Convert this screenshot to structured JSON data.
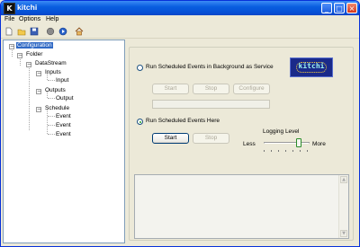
{
  "window": {
    "title": "kitchi",
    "icon_letter": "K",
    "controls": [
      "minimize-icon",
      "maximize-icon",
      "close-icon"
    ]
  },
  "menubar": {
    "items": [
      {
        "label": "File"
      },
      {
        "label": "Options"
      },
      {
        "label": "Help"
      }
    ]
  },
  "toolbar": {
    "tools": [
      "new-document-icon",
      "open-folder-icon",
      "save-icon",
      "record-icon",
      "play-icon",
      "home-icon"
    ]
  },
  "tree": {
    "nodes": [
      {
        "label": "Configuration",
        "selected": true
      },
      {
        "label": "Folder"
      },
      {
        "label": "DataStream"
      },
      {
        "label": "Inputs"
      },
      {
        "label": "Input"
      },
      {
        "label": "Outputs"
      },
      {
        "label": "Output"
      },
      {
        "label": "Schedule"
      },
      {
        "label": "Event"
      },
      {
        "label": "Event"
      },
      {
        "label": "Event"
      }
    ]
  },
  "service": {
    "option_label": "Run Scheduled Events in Background as Service",
    "selected": false,
    "start_label": "Start",
    "stop_label": "Stop",
    "configure_label": "Configure",
    "status_value": ""
  },
  "logo": {
    "text": "kitchi"
  },
  "local": {
    "option_label": "Run Scheduled Events Here",
    "selected": true,
    "start_label": "Start",
    "stop_label": "Stop"
  },
  "logging": {
    "label": "Logging Level",
    "less_label": "Less",
    "more_label": "More",
    "level_fraction": 0.8
  },
  "log_output": {
    "text": ""
  },
  "colors": {
    "titlebar": "#0A5FE0",
    "selection": "#316AC5",
    "logo_background": "#1a2a8a",
    "logo_text": "#9CF4F0"
  }
}
